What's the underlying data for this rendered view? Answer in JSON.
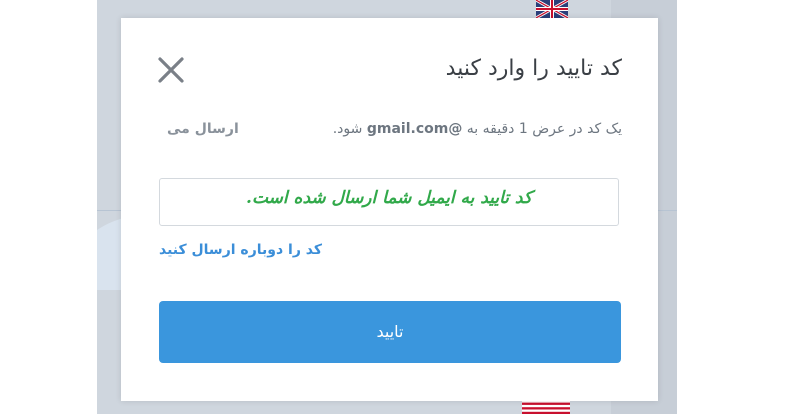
{
  "modal": {
    "title": "کد تایید را وارد کنید",
    "info_text_prefix": "یک کد در عرض 1 دقیقه به",
    "info_email": "@gmail.com",
    "info_text_suffix": "شود.",
    "info_sent": "ارسال می",
    "code_message": "کد تایید به ایمیل شما ارسال شده است.",
    "resend_link": "کد را دوباره ارسال کنید",
    "confirm_button": "تایید",
    "close_icon": "close-icon"
  },
  "colors": {
    "primary": "#3a96dd",
    "success_text": "#31a94a",
    "link": "#3b8ed8",
    "title": "#3a3f45"
  }
}
